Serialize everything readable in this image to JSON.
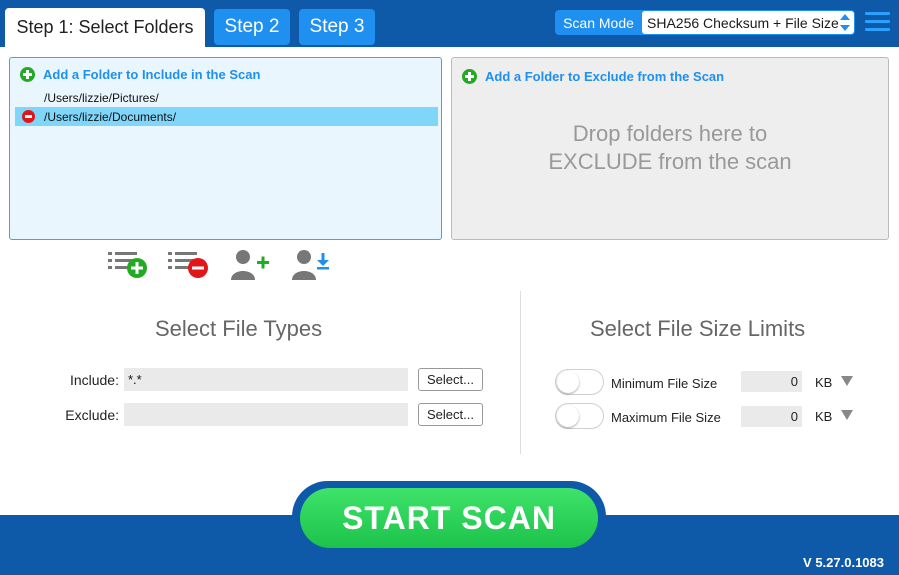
{
  "tabs": [
    {
      "label": "Step 1:  Select Folders"
    },
    {
      "label": "Step 2"
    },
    {
      "label": "Step 3"
    }
  ],
  "scan_mode": {
    "label": "Scan Mode",
    "value": "SHA256 Checksum + File Size"
  },
  "include_panel": {
    "header": "Add a Folder to Include in the Scan",
    "folders": [
      "/Users/lizzie/Pictures/",
      "/Users/lizzie/Documents/"
    ]
  },
  "exclude_panel": {
    "header": "Add a Folder to Exclude from the Scan",
    "drop_line1": "Drop folders here to",
    "drop_line2": "EXCLUDE from the scan"
  },
  "file_types": {
    "title": "Select File Types",
    "include_label": "Include:",
    "include_value": "*.*",
    "exclude_label": "Exclude:",
    "exclude_value": "",
    "select_label": "Select..."
  },
  "size_limits": {
    "title": "Select File Size Limits",
    "min_label": "Minimum File Size",
    "min_value": "0",
    "max_label": "Maximum File Size",
    "max_value": "0",
    "unit": "KB"
  },
  "start_button": "START  SCAN",
  "version": "V 5.27.0.1083"
}
